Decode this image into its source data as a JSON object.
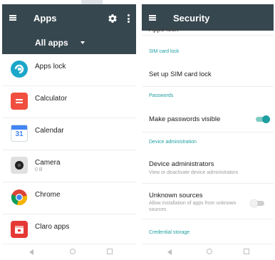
{
  "left": {
    "title": "Apps",
    "filter_label": "All apps",
    "apps": [
      {
        "name": "Apps lock",
        "sub": "",
        "icon": "apps-lock-icon",
        "color": "#1ba7c9"
      },
      {
        "name": "Calculator",
        "sub": "",
        "icon": "calculator-icon",
        "color": "#f04e3e"
      },
      {
        "name": "Calendar",
        "sub": "",
        "icon": "calendar-icon",
        "color": "#4285f4",
        "glyph": "31"
      },
      {
        "name": "Camera",
        "sub": "0 B",
        "icon": "camera-icon",
        "color": "#e0e0e0"
      },
      {
        "name": "Chrome",
        "sub": "",
        "icon": "chrome-icon",
        "color": "#ffffff"
      },
      {
        "name": "Claro apps",
        "sub": "",
        "icon": "claro-apps-icon",
        "color": "#e53935"
      }
    ]
  },
  "right": {
    "title": "Security",
    "cut_item": "Apps lock",
    "sections": {
      "sim_header": "SIM card lock",
      "sim_item": "Set up SIM card lock",
      "passwords_header": "Passwords",
      "passwords_item": "Make passwords visible",
      "device_admin_header": "Device administration",
      "device_admins_title": "Device administrators",
      "device_admins_summary": "View or deactivate device administrators",
      "unknown_title": "Unknown sources",
      "unknown_summary": "Allow installation of apps from unknown sources",
      "credential_header": "Credential storage"
    },
    "toggles": {
      "passwords_visible": true,
      "unknown_sources": false
    }
  },
  "colors": {
    "toolbar": "#37474f",
    "accent": "#1e9fa0"
  }
}
